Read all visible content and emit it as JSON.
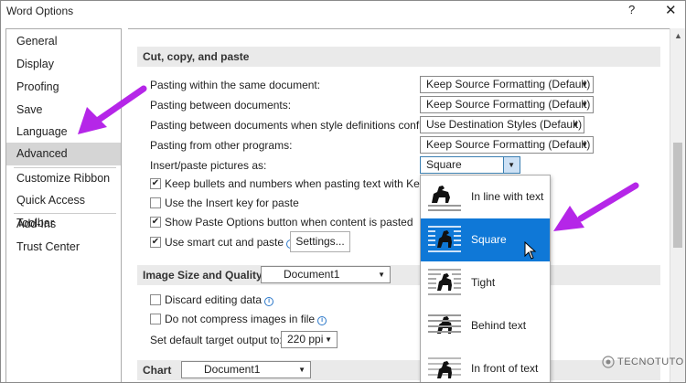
{
  "window": {
    "title": "Word Options",
    "help": "?",
    "close": "✕"
  },
  "nav": {
    "items": [
      "General",
      "Display",
      "Proofing",
      "Save",
      "Language",
      "Advanced",
      "Customize Ribbon",
      "Quick Access Toolbar",
      "Add-Ins",
      "Trust Center"
    ],
    "selected": "Advanced"
  },
  "cut_copy_paste": {
    "header": "Cut, copy, and paste",
    "rows": [
      {
        "label": "Pasting within the same document:",
        "value": "Keep Source Formatting (Default)"
      },
      {
        "label": "Pasting between documents:",
        "value": "Keep Source Formatting (Default)"
      },
      {
        "label": "Pasting between documents when style definitions conflict:",
        "value": "Use Destination Styles (Default)"
      },
      {
        "label": "Pasting from other programs:",
        "value": "Keep Source Formatting (Default)"
      },
      {
        "label": "Insert/paste pictures as:",
        "value": "Square"
      }
    ],
    "checks": [
      {
        "label": "Keep bullets and numbers when pasting text with Keep Text Only option",
        "checked": true
      },
      {
        "label": "Use the Insert key for paste",
        "checked": false
      },
      {
        "label": "Show Paste Options button when content is pasted",
        "checked": true
      },
      {
        "label": "Use smart cut and paste",
        "checked": true
      }
    ],
    "settings_button": "Settings..."
  },
  "image_size": {
    "header": "Image Size and Quality",
    "document": "Document1",
    "checks": [
      {
        "label": "Discard editing data",
        "checked": false
      },
      {
        "label": "Do not compress images in file",
        "checked": false
      }
    ],
    "resolution_label": "Set default target output to:",
    "resolution_value": "220 ppi"
  },
  "chart": {
    "header": "Chart",
    "document": "Document1"
  },
  "picture_options": {
    "items": [
      "In line with text",
      "Square",
      "Tight",
      "Behind text",
      "In front of text"
    ],
    "selected": "Square"
  },
  "watermark": "TECNOTUTO",
  "colors": {
    "accent": "#0f78d7",
    "arrow": "#b526e8",
    "selected_nav": "#d5d5d5"
  }
}
